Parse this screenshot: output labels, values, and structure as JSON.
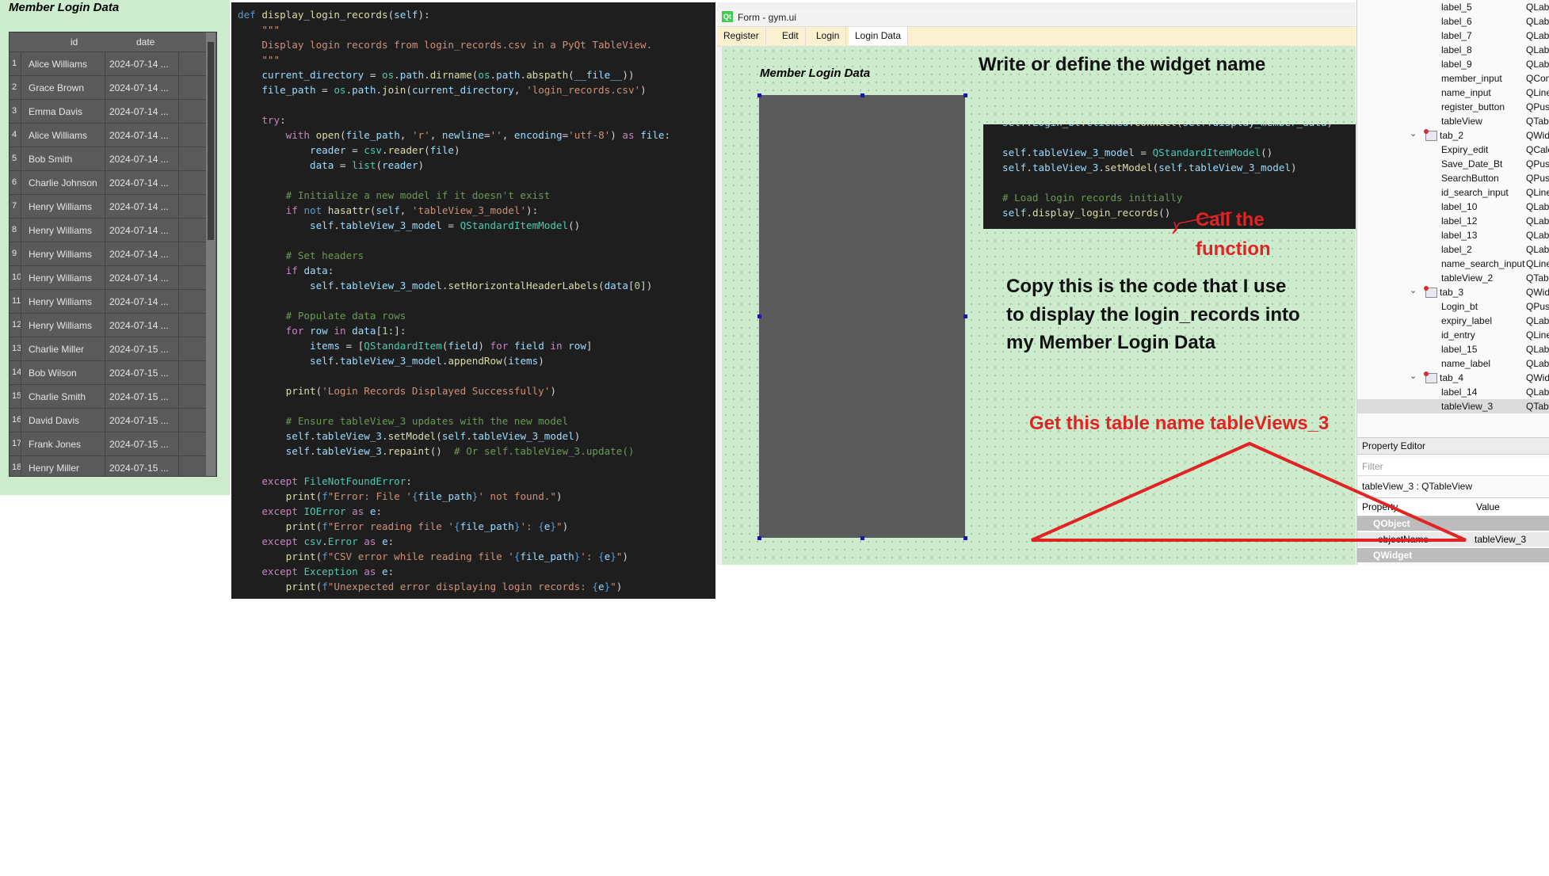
{
  "panel1": {
    "title": "Member Login Data",
    "columns": [
      "id",
      "date"
    ],
    "rows": [
      {
        "n": "1",
        "name": "Alice Williams",
        "date": "2024-07-14 ..."
      },
      {
        "n": "2",
        "name": "Grace Brown",
        "date": "2024-07-14 ..."
      },
      {
        "n": "3",
        "name": "Emma Davis",
        "date": "2024-07-14 ..."
      },
      {
        "n": "4",
        "name": "Alice Williams",
        "date": "2024-07-14 ..."
      },
      {
        "n": "5",
        "name": "Bob Smith",
        "date": "2024-07-14 ..."
      },
      {
        "n": "6",
        "name": "Charlie Johnson",
        "date": "2024-07-14 ..."
      },
      {
        "n": "7",
        "name": "Henry Williams",
        "date": "2024-07-14 ..."
      },
      {
        "n": "8",
        "name": "Henry Williams",
        "date": "2024-07-14 ..."
      },
      {
        "n": "9",
        "name": "Henry Williams",
        "date": "2024-07-14 ..."
      },
      {
        "n": "10",
        "name": "Henry Williams",
        "date": "2024-07-14 ..."
      },
      {
        "n": "11",
        "name": "Henry Williams",
        "date": "2024-07-14 ..."
      },
      {
        "n": "12",
        "name": "Henry Williams",
        "date": "2024-07-14 ..."
      },
      {
        "n": "13",
        "name": "Charlie Miller",
        "date": "2024-07-15 ..."
      },
      {
        "n": "14",
        "name": "Bob Wilson",
        "date": "2024-07-15 ..."
      },
      {
        "n": "15",
        "name": "Charlie Smith",
        "date": "2024-07-15 ..."
      },
      {
        "n": "16",
        "name": "David Davis",
        "date": "2024-07-15 ..."
      },
      {
        "n": "17",
        "name": "Frank Jones",
        "date": "2024-07-15 ..."
      },
      {
        "n": "18",
        "name": "Henry Miller",
        "date": "2024-07-15 ..."
      }
    ]
  },
  "code": [
    "<span class='df'>def</span> <span class='fn'>display_login_records</span>(<span class='vr'>self</span>):",
    "    <span class='st'>\"\"\"</span>",
    "    <span class='st'>Display login records from login_records.csv in a PyQt TableView.</span>",
    "    <span class='st'>\"\"\"</span>",
    "    <span class='vr'>current_directory</span> = <span class='cl'>os</span>.<span class='vr'>path</span>.<span class='fn'>dirname</span>(<span class='cl'>os</span>.<span class='vr'>path</span>.<span class='fn'>abspath</span>(<span class='vr'>__file__</span>))",
    "    <span class='vr'>file_path</span> = <span class='cl'>os</span>.<span class='vr'>path</span>.<span class='fn'>join</span>(<span class='vr'>current_directory</span>, <span class='st'>'login_records.csv'</span>)",
    "",
    "    <span class='kw'>try</span>:",
    "        <span class='kw'>with</span> <span class='fn'>open</span>(<span class='vr'>file_path</span>, <span class='st'>'r'</span>, <span class='vr'>newline</span>=<span class='st'>''</span>, <span class='vr'>encoding</span>=<span class='st'>'utf-8'</span>) <span class='kw'>as</span> <span class='vr'>file</span>:",
    "            <span class='vr'>reader</span> = <span class='cl'>csv</span>.<span class='fn'>reader</span>(<span class='vr'>file</span>)",
    "            <span class='vr'>data</span> = <span class='cl'>list</span>(<span class='vr'>reader</span>)",
    "",
    "        <span class='cm'># Initialize a new model if it doesn't exist</span>",
    "        <span class='kw'>if</span> <span class='df'>not</span> <span class='fn'>hasattr</span>(<span class='vr'>self</span>, <span class='st'>'tableView_3_model'</span>):",
    "            <span class='vr'>self</span>.<span class='vr'>tableView_3_model</span> = <span class='cl'>QStandardItemModel</span>()",
    "",
    "        <span class='cm'># Set headers</span>",
    "        <span class='kw'>if</span> <span class='vr'>data</span>:",
    "            <span class='vr'>self</span>.<span class='vr'>tableView_3_model</span>.<span class='fn'>setHorizontalHeaderLabels</span>(<span class='vr'>data</span>[<span class='nm'>0</span>])",
    "",
    "        <span class='cm'># Populate data rows</span>",
    "        <span class='kw'>for</span> <span class='vr'>row</span> <span class='kw'>in</span> <span class='vr'>data</span>[<span class='nm'>1</span>:]:",
    "            <span class='vr'>items</span> = [<span class='cl'>QStandardItem</span>(<span class='vr'>field</span>) <span class='kw'>for</span> <span class='vr'>field</span> <span class='kw'>in</span> <span class='vr'>row</span>]",
    "            <span class='vr'>self</span>.<span class='vr'>tableView_3_model</span>.<span class='fn'>appendRow</span>(<span class='vr'>items</span>)",
    "",
    "        <span class='fn'>print</span>(<span class='st'>'Login Records Displayed Successfully'</span>)",
    "",
    "        <span class='cm'># Ensure tableView_3 updates with the new model</span>",
    "        <span class='vr'>self</span>.<span class='vr'>tableView_3</span>.<span class='fn'>setModel</span>(<span class='vr'>self</span>.<span class='vr'>tableView_3_model</span>)",
    "        <span class='vr'>self</span>.<span class='vr'>tableView_3</span>.<span class='fn'>repaint</span>()  <span class='cm'># Or self.tableView_3.update()</span>",
    "",
    "    <span class='kw'>except</span> <span class='cl'>FileNotFoundError</span>:",
    "        <span class='fn'>print</span>(<span class='df'>f</span><span class='st'>\"Error: File '</span><span class='df'>{</span><span class='vr'>file_path</span><span class='df'>}</span><span class='st'>' not found.\"</span>)",
    "    <span class='kw'>except</span> <span class='cl'>IOError</span> <span class='kw'>as</span> <span class='vr'>e</span>:",
    "        <span class='fn'>print</span>(<span class='df'>f</span><span class='st'>\"Error reading file '</span><span class='df'>{</span><span class='vr'>file_path</span><span class='df'>}</span><span class='st'>': </span><span class='df'>{</span><span class='vr'>e</span><span class='df'>}</span><span class='st'>\"</span>)",
    "    <span class='kw'>except</span> <span class='cl'>csv</span>.<span class='cl'>Error</span> <span class='kw'>as</span> <span class='vr'>e</span>:",
    "        <span class='fn'>print</span>(<span class='df'>f</span><span class='st'>\"CSV error while reading file '</span><span class='df'>{</span><span class='vr'>file_path</span><span class='df'>}</span><span class='st'>': </span><span class='df'>{</span><span class='vr'>e</span><span class='df'>}</span><span class='st'>\"</span>)",
    "    <span class='kw'>except</span> <span class='cl'>Exception</span> <span class='kw'>as</span> <span class='vr'>e</span>:",
    "        <span class='fn'>print</span>(<span class='df'>f</span><span class='st'>\"Unexpected error displaying login records: </span><span class='df'>{</span><span class='vr'>e</span><span class='df'>}</span><span class='st'>\"</span>)"
  ],
  "qt_form": {
    "window_title": "Form - gym.ui",
    "tabs": [
      "Register",
      "Edit",
      "Login",
      "Login Data"
    ],
    "active_tab": "Login Data",
    "form_title": "Member Login Data",
    "annotation_heading": "Write or  define the widget name",
    "snippet": [
      "<span class='vr'>self</span>.<span class='vr'>Login_bt</span>.<span class='vr'>clicked</span>.<span class='fn'>connect</span>(<span class='vr'>self</span>.<span class='vr'>display_member_data</span>)",
      "",
      "<span class='vr'>self</span>.<span class='vr'>tableView_3_model</span> = <span class='cl'>QStandardItemModel</span>()",
      "<span class='vr'>self</span>.<span class='vr'>tableView_3</span>.<span class='fn'>setModel</span>(<span class='vr'>self</span>.<span class='vr'>tableView_3_model</span>)",
      "",
      "<span class='cm'># Load login records initially</span>",
      "<span class='vr'>self</span>.<span class='fn'>display_login_records</span>()"
    ],
    "call_note_1": "Call the",
    "call_note_2": "function",
    "copy_note_1": "Copy this is the code that I use",
    "copy_note_2": "to display the login_records into",
    "copy_note_3": "my Member Login Data",
    "table_note": "Get this table name tableViews_3"
  },
  "inspector": {
    "objects": [
      {
        "name": "label_5",
        "cls": "QLabe",
        "indent": 1
      },
      {
        "name": "label_6",
        "cls": "QLabe",
        "indent": 1
      },
      {
        "name": "label_7",
        "cls": "QLabe",
        "indent": 1
      },
      {
        "name": "label_8",
        "cls": "QLabe",
        "indent": 1
      },
      {
        "name": "label_9",
        "cls": "QLabe",
        "indent": 1
      },
      {
        "name": "member_input",
        "cls": "QCom",
        "indent": 1
      },
      {
        "name": "name_input",
        "cls": "QLine",
        "indent": 1
      },
      {
        "name": "register_button",
        "cls": "QPush",
        "indent": 1
      },
      {
        "name": "tableView",
        "cls": "QTable",
        "indent": 1
      },
      {
        "name": "tab_2",
        "cls": "QWidg",
        "indent": 0
      },
      {
        "name": "Expiry_edit",
        "cls": "QCale",
        "indent": 1
      },
      {
        "name": "Save_Date_Bt",
        "cls": "QPush",
        "indent": 1
      },
      {
        "name": "SearchButton",
        "cls": "QPush",
        "indent": 1
      },
      {
        "name": "id_search_input",
        "cls": "QLine",
        "indent": 1
      },
      {
        "name": "label_10",
        "cls": "QLabe",
        "indent": 1
      },
      {
        "name": "label_12",
        "cls": "QLabe",
        "indent": 1
      },
      {
        "name": "label_13",
        "cls": "QLabe",
        "indent": 1
      },
      {
        "name": "label_2",
        "cls": "QLabe",
        "indent": 1
      },
      {
        "name": "name_search_input",
        "cls": "QLine",
        "indent": 1
      },
      {
        "name": "tableView_2",
        "cls": "QTable",
        "indent": 1
      },
      {
        "name": "tab_3",
        "cls": "QWidg",
        "indent": 0
      },
      {
        "name": "Login_bt",
        "cls": "QPush",
        "indent": 1
      },
      {
        "name": "expiry_label",
        "cls": "QLabe",
        "indent": 1
      },
      {
        "name": "id_entry",
        "cls": "QLine",
        "indent": 1
      },
      {
        "name": "label_15",
        "cls": "QLabe",
        "indent": 1
      },
      {
        "name": "name_label",
        "cls": "QLabe",
        "indent": 1
      },
      {
        "name": "tab_4",
        "cls": "QWidg",
        "indent": 0
      },
      {
        "name": "label_14",
        "cls": "QLabe",
        "indent": 1
      },
      {
        "name": "tableView_3",
        "cls": "QTable",
        "indent": 1
      }
    ],
    "selected": "tableView_3",
    "property_editor_title": "Property Editor",
    "filter_placeholder": "Filter",
    "object_class": "tableView_3 : QTableView",
    "col_property": "Property",
    "col_value": "Value",
    "group1": "QObject",
    "prop_name": "objectName",
    "prop_value": "tableView_3",
    "group2": "QWidget"
  },
  "colors": {
    "annotation_red": "#e02424",
    "form_green": "#cdeccd",
    "table_gray": "#5a5a5a"
  }
}
